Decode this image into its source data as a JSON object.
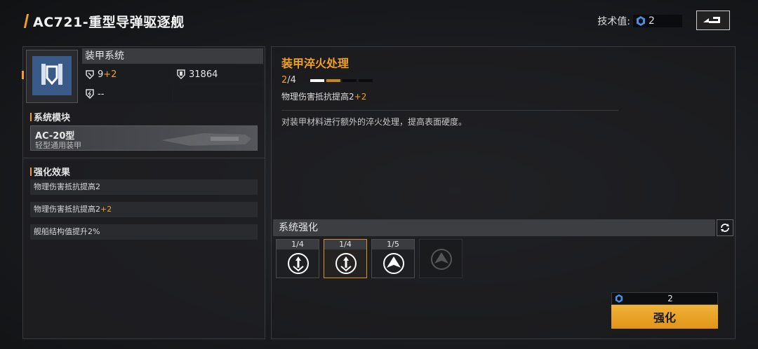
{
  "header": {
    "title": "AC721-重型导弹驱逐舰",
    "tech_label": "技术值:",
    "tech_value": "2"
  },
  "left": {
    "system_name": "装甲系统",
    "stats": {
      "level_base": "9",
      "level_plus": "+2",
      "hp": "31864",
      "extra": "--"
    },
    "module_section": "系统模块",
    "module": {
      "name": "AC-20型",
      "type": "轻型通用装甲"
    },
    "effects_section": "强化效果",
    "effects": [
      {
        "text": "物理伤害抵抗提高2",
        "plus": ""
      },
      {
        "text": "物理伤害抵抗提高2",
        "plus": "+2"
      },
      {
        "text": "舰船结构值提升2%",
        "plus": ""
      }
    ]
  },
  "right": {
    "upgrade_title": "装甲淬火处理",
    "level_current": "2",
    "level_max": "/4",
    "pips": [
      1,
      0.5,
      0,
      0
    ],
    "effect_text": "物理伤害抵抗提高2",
    "effect_plus": "+2",
    "description": "对装甲材料进行额外的淬火处理，提高表面硬度。",
    "enhance_section": "系统强化",
    "slots": [
      {
        "count": "1/4",
        "icon": "upgrade-arrow-icon"
      },
      {
        "count": "1/4",
        "icon": "upgrade-arrow-icon"
      },
      {
        "count": "1/5",
        "icon": "ship-emblem-icon"
      }
    ],
    "cost_value": "2",
    "enhance_button": "强化"
  },
  "colors": {
    "accent": "#f0a020",
    "button": "#e8a428",
    "bg": "#1a1b1e"
  }
}
